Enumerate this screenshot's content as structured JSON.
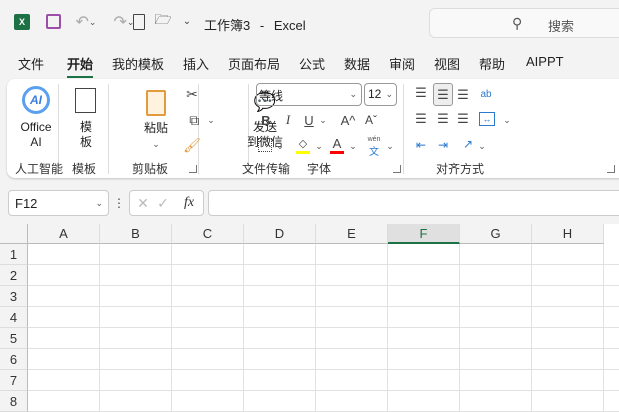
{
  "titlebar": {
    "title": "工作簿3",
    "separator": "-",
    "app": "Excel",
    "search_placeholder": "搜索"
  },
  "tabs": [
    "文件",
    "开始",
    "我的模板",
    "插入",
    "页面布局",
    "公式",
    "数据",
    "审阅",
    "视图",
    "帮助",
    "AIPPT"
  ],
  "active_tab": "开始",
  "ribbon": {
    "ai": {
      "icon_text": "AI",
      "label1": "Office",
      "label2": "AI",
      "group": "人工智能"
    },
    "template": {
      "label1": "模",
      "label2": "板",
      "group": "模板"
    },
    "clipboard": {
      "paste1": "粘贴",
      "group": "剪贴板"
    },
    "transfer": {
      "label1": "发送",
      "label2": "到微信",
      "group": "文件传输"
    },
    "font": {
      "name": "等线",
      "size": "12",
      "bold": "B",
      "italic": "I",
      "underline": "U",
      "grow": "A^",
      "shrink": "Aˇ",
      "font_color": "A",
      "phonetic_top": "wén",
      "phonetic_bottom": "文",
      "group": "字体"
    },
    "align": {
      "wrap_text": "ab",
      "group": "对齐方式"
    }
  },
  "formula_bar": {
    "name_box": "F12",
    "fx": "fx",
    "value": ""
  },
  "colors": {
    "highlight": "#ffff00",
    "font_color": "#ff0000",
    "accent": "#1e7145"
  },
  "grid": {
    "columns": [
      "A",
      "B",
      "C",
      "D",
      "E",
      "F",
      "G",
      "H"
    ],
    "rows": [
      "1",
      "2",
      "3",
      "4",
      "5",
      "6",
      "7",
      "8"
    ],
    "selected_column": "F"
  }
}
